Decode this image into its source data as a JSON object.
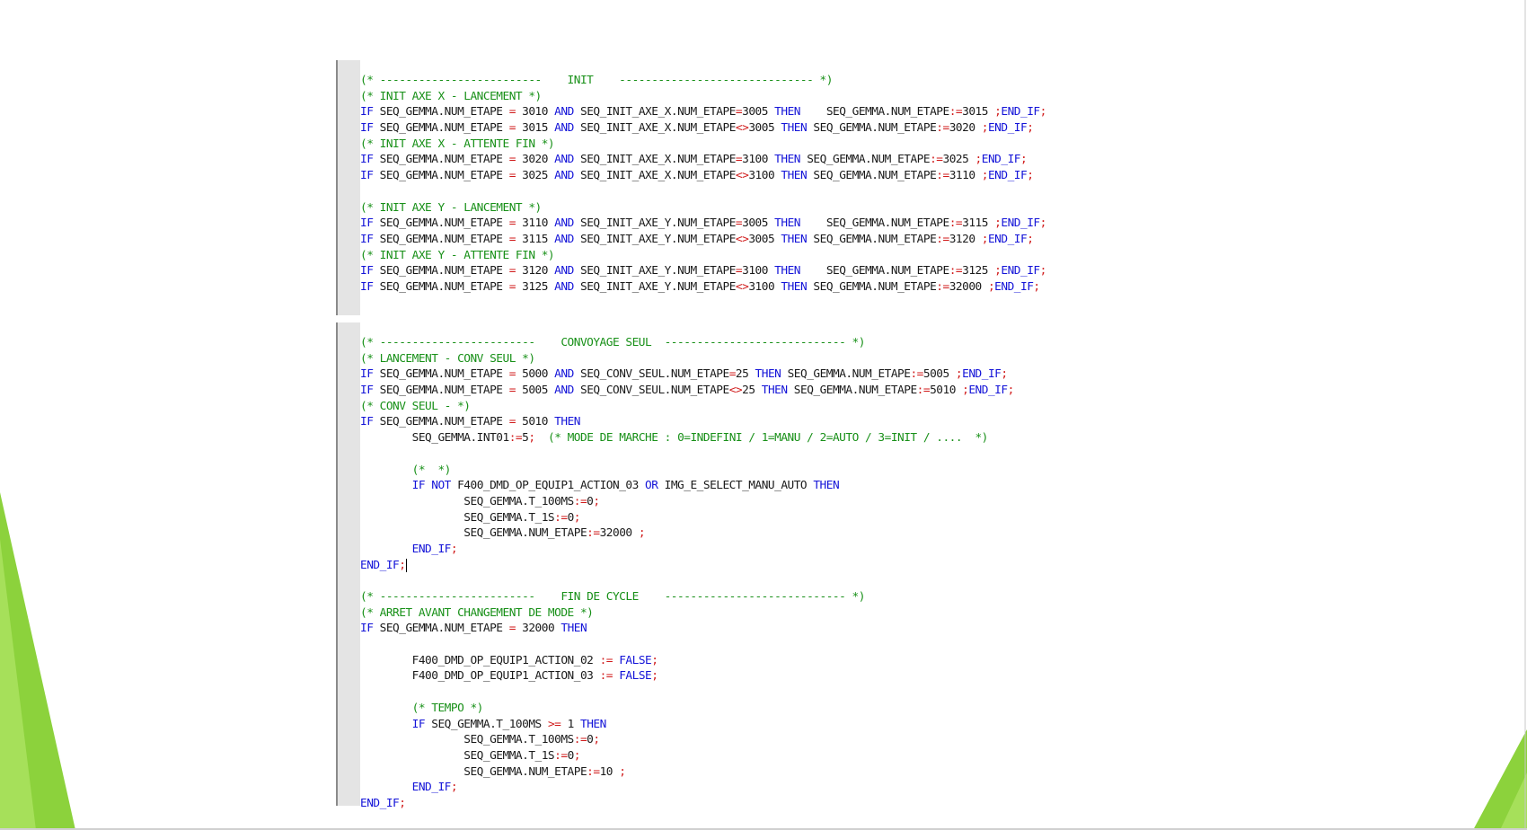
{
  "colors": {
    "keyword": "#1414d8",
    "operator": "#d01a1a",
    "comment": "#189018",
    "identifier": "#1a1a1a",
    "gutter": "#e4e4e4",
    "slide_accent": "#8cd23c"
  },
  "editors": [
    {
      "name": "init",
      "lines": [
        [
          [
            "cm",
            "(* -------------------------    INIT    ------------------------------ *)"
          ]
        ],
        [
          [
            "cm",
            "(* INIT AXE X - LANCEMENT *)"
          ]
        ],
        [
          [
            "kw",
            "IF"
          ],
          [
            "id",
            " SEQ_GEMMA.NUM_ETAPE "
          ],
          [
            "op",
            "="
          ],
          [
            "id",
            " 3010 "
          ],
          [
            "kw",
            "AND"
          ],
          [
            "id",
            " SEQ_INIT_AXE_X.NUM_ETAPE"
          ],
          [
            "op",
            "="
          ],
          [
            "id",
            "3005 "
          ],
          [
            "kw",
            "THEN"
          ],
          [
            "id",
            "    SEQ_GEMMA.NUM_ETAPE"
          ],
          [
            "op",
            ":="
          ],
          [
            "id",
            "3015 "
          ],
          [
            "op",
            ";"
          ],
          [
            "kw",
            "END_IF"
          ],
          [
            "op",
            ";"
          ]
        ],
        [
          [
            "kw",
            "IF"
          ],
          [
            "id",
            " SEQ_GEMMA.NUM_ETAPE "
          ],
          [
            "op",
            "="
          ],
          [
            "id",
            " 3015 "
          ],
          [
            "kw",
            "AND"
          ],
          [
            "id",
            " SEQ_INIT_AXE_X.NUM_ETAPE"
          ],
          [
            "op",
            "<>"
          ],
          [
            "id",
            "3005 "
          ],
          [
            "kw",
            "THEN"
          ],
          [
            "id",
            " SEQ_GEMMA.NUM_ETAPE"
          ],
          [
            "op",
            ":="
          ],
          [
            "id",
            "3020 "
          ],
          [
            "op",
            ";"
          ],
          [
            "kw",
            "END_IF"
          ],
          [
            "op",
            ";"
          ]
        ],
        [
          [
            "cm",
            "(* INIT AXE X - ATTENTE FIN *)"
          ]
        ],
        [
          [
            "kw",
            "IF"
          ],
          [
            "id",
            " SEQ_GEMMA.NUM_ETAPE "
          ],
          [
            "op",
            "="
          ],
          [
            "id",
            " 3020 "
          ],
          [
            "kw",
            "AND"
          ],
          [
            "id",
            " SEQ_INIT_AXE_X.NUM_ETAPE"
          ],
          [
            "op",
            "="
          ],
          [
            "id",
            "3100 "
          ],
          [
            "kw",
            "THEN"
          ],
          [
            "id",
            " SEQ_GEMMA.NUM_ETAPE"
          ],
          [
            "op",
            ":="
          ],
          [
            "id",
            "3025 "
          ],
          [
            "op",
            ";"
          ],
          [
            "kw",
            "END_IF"
          ],
          [
            "op",
            ";"
          ]
        ],
        [
          [
            "kw",
            "IF"
          ],
          [
            "id",
            " SEQ_GEMMA.NUM_ETAPE "
          ],
          [
            "op",
            "="
          ],
          [
            "id",
            " 3025 "
          ],
          [
            "kw",
            "AND"
          ],
          [
            "id",
            " SEQ_INIT_AXE_X.NUM_ETAPE"
          ],
          [
            "op",
            "<>"
          ],
          [
            "id",
            "3100 "
          ],
          [
            "kw",
            "THEN"
          ],
          [
            "id",
            " SEQ_GEMMA.NUM_ETAPE"
          ],
          [
            "op",
            ":="
          ],
          [
            "id",
            "3110 "
          ],
          [
            "op",
            ";"
          ],
          [
            "kw",
            "END_IF"
          ],
          [
            "op",
            ";"
          ]
        ],
        [],
        [
          [
            "cm",
            "(* INIT AXE Y - LANCEMENT *)"
          ]
        ],
        [
          [
            "kw",
            "IF"
          ],
          [
            "id",
            " SEQ_GEMMA.NUM_ETAPE "
          ],
          [
            "op",
            "="
          ],
          [
            "id",
            " 3110 "
          ],
          [
            "kw",
            "AND"
          ],
          [
            "id",
            " SEQ_INIT_AXE_Y.NUM_ETAPE"
          ],
          [
            "op",
            "="
          ],
          [
            "id",
            "3005 "
          ],
          [
            "kw",
            "THEN"
          ],
          [
            "id",
            "    SEQ_GEMMA.NUM_ETAPE"
          ],
          [
            "op",
            ":="
          ],
          [
            "id",
            "3115 "
          ],
          [
            "op",
            ";"
          ],
          [
            "kw",
            "END_IF"
          ],
          [
            "op",
            ";"
          ]
        ],
        [
          [
            "kw",
            "IF"
          ],
          [
            "id",
            " SEQ_GEMMA.NUM_ETAPE "
          ],
          [
            "op",
            "="
          ],
          [
            "id",
            " 3115 "
          ],
          [
            "kw",
            "AND"
          ],
          [
            "id",
            " SEQ_INIT_AXE_Y.NUM_ETAPE"
          ],
          [
            "op",
            "<>"
          ],
          [
            "id",
            "3005 "
          ],
          [
            "kw",
            "THEN"
          ],
          [
            "id",
            " SEQ_GEMMA.NUM_ETAPE"
          ],
          [
            "op",
            ":="
          ],
          [
            "id",
            "3120 "
          ],
          [
            "op",
            ";"
          ],
          [
            "kw",
            "END_IF"
          ],
          [
            "op",
            ";"
          ]
        ],
        [
          [
            "cm",
            "(* INIT AXE Y - ATTENTE FIN *)"
          ]
        ],
        [
          [
            "kw",
            "IF"
          ],
          [
            "id",
            " SEQ_GEMMA.NUM_ETAPE "
          ],
          [
            "op",
            "="
          ],
          [
            "id",
            " 3120 "
          ],
          [
            "kw",
            "AND"
          ],
          [
            "id",
            " SEQ_INIT_AXE_Y.NUM_ETAPE"
          ],
          [
            "op",
            "="
          ],
          [
            "id",
            "3100 "
          ],
          [
            "kw",
            "THEN"
          ],
          [
            "id",
            "    SEQ_GEMMA.NUM_ETAPE"
          ],
          [
            "op",
            ":="
          ],
          [
            "id",
            "3125 "
          ],
          [
            "op",
            ";"
          ],
          [
            "kw",
            "END_IF"
          ],
          [
            "op",
            ";"
          ]
        ],
        [
          [
            "kw",
            "IF"
          ],
          [
            "id",
            " SEQ_GEMMA.NUM_ETAPE "
          ],
          [
            "op",
            "="
          ],
          [
            "id",
            " 3125 "
          ],
          [
            "kw",
            "AND"
          ],
          [
            "id",
            " SEQ_INIT_AXE_Y.NUM_ETAPE"
          ],
          [
            "op",
            "<>"
          ],
          [
            "id",
            "3100 "
          ],
          [
            "kw",
            "THEN"
          ],
          [
            "id",
            " SEQ_GEMMA.NUM_ETAPE"
          ],
          [
            "op",
            ":="
          ],
          [
            "id",
            "32000 "
          ],
          [
            "op",
            ";"
          ],
          [
            "kw",
            "END_IF"
          ],
          [
            "op",
            ";"
          ]
        ]
      ]
    },
    {
      "name": "convoyage",
      "lines": [
        [
          [
            "cm",
            "(* ------------------------    CONVOYAGE SEUL  ---------------------------- *)"
          ]
        ],
        [
          [
            "cm",
            "(* LANCEMENT - CONV SEUL *)"
          ]
        ],
        [
          [
            "kw",
            "IF"
          ],
          [
            "id",
            " SEQ_GEMMA.NUM_ETAPE "
          ],
          [
            "op",
            "="
          ],
          [
            "id",
            " 5000 "
          ],
          [
            "kw",
            "AND"
          ],
          [
            "id",
            " SEQ_CONV_SEUL.NUM_ETAPE"
          ],
          [
            "op",
            "="
          ],
          [
            "id",
            "25 "
          ],
          [
            "kw",
            "THEN"
          ],
          [
            "id",
            " SEQ_GEMMA.NUM_ETAPE"
          ],
          [
            "op",
            ":="
          ],
          [
            "id",
            "5005 "
          ],
          [
            "op",
            ";"
          ],
          [
            "kw",
            "END_IF"
          ],
          [
            "op",
            ";"
          ]
        ],
        [
          [
            "kw",
            "IF"
          ],
          [
            "id",
            " SEQ_GEMMA.NUM_ETAPE "
          ],
          [
            "op",
            "="
          ],
          [
            "id",
            " 5005 "
          ],
          [
            "kw",
            "AND"
          ],
          [
            "id",
            " SEQ_CONV_SEUL.NUM_ETAPE"
          ],
          [
            "op",
            "<>"
          ],
          [
            "id",
            "25 "
          ],
          [
            "kw",
            "THEN"
          ],
          [
            "id",
            " SEQ_GEMMA.NUM_ETAPE"
          ],
          [
            "op",
            ":="
          ],
          [
            "id",
            "5010 "
          ],
          [
            "op",
            ";"
          ],
          [
            "kw",
            "END_IF"
          ],
          [
            "op",
            ";"
          ]
        ],
        [
          [
            "cm",
            "(* CONV SEUL - *)"
          ]
        ],
        [
          [
            "kw",
            "IF"
          ],
          [
            "id",
            " SEQ_GEMMA.NUM_ETAPE "
          ],
          [
            "op",
            "="
          ],
          [
            "id",
            " 5010 "
          ],
          [
            "kw",
            "THEN"
          ]
        ],
        [
          [
            "id",
            "        SEQ_GEMMA.INT01"
          ],
          [
            "op",
            ":="
          ],
          [
            "id",
            "5"
          ],
          [
            "op",
            ";"
          ],
          [
            "id",
            "  "
          ],
          [
            "cm",
            "(* MODE DE MARCHE : 0=INDEFINI / 1=MANU / 2=AUTO / 3=INIT / ....  *)"
          ]
        ],
        [],
        [
          [
            "id",
            "        "
          ],
          [
            "cm",
            "(*  *)"
          ]
        ],
        [
          [
            "id",
            "        "
          ],
          [
            "kw",
            "IF NOT"
          ],
          [
            "id",
            " F400_DMD_OP_EQUIP1_ACTION_03 "
          ],
          [
            "kw",
            "OR"
          ],
          [
            "id",
            " IMG_E_SELECT_MANU_AUTO "
          ],
          [
            "kw",
            "THEN"
          ]
        ],
        [
          [
            "id",
            "                SEQ_GEMMA.T_100MS"
          ],
          [
            "op",
            ":="
          ],
          [
            "id",
            "0"
          ],
          [
            "op",
            ";"
          ]
        ],
        [
          [
            "id",
            "                SEQ_GEMMA.T_1S"
          ],
          [
            "op",
            ":="
          ],
          [
            "id",
            "0"
          ],
          [
            "op",
            ";"
          ]
        ],
        [
          [
            "id",
            "                SEQ_GEMMA.NUM_ETAPE"
          ],
          [
            "op",
            ":="
          ],
          [
            "id",
            "32000 "
          ],
          [
            "op",
            ";"
          ]
        ],
        [
          [
            "id",
            "        "
          ],
          [
            "kw",
            "END_IF"
          ],
          [
            "op",
            ";"
          ]
        ],
        [
          [
            "kw",
            "END_IF"
          ],
          [
            "op",
            ";"
          ],
          [
            "caret",
            ""
          ]
        ],
        [],
        [
          [
            "cm",
            "(* ------------------------    FIN DE CYCLE    ---------------------------- *)"
          ]
        ],
        [
          [
            "cm",
            "(* ARRET AVANT CHANGEMENT DE MODE *)"
          ]
        ],
        [
          [
            "kw",
            "IF"
          ],
          [
            "id",
            " SEQ_GEMMA.NUM_ETAPE "
          ],
          [
            "op",
            "="
          ],
          [
            "id",
            " 32000 "
          ],
          [
            "kw",
            "THEN"
          ]
        ],
        [],
        [
          [
            "id",
            "        F400_DMD_OP_EQUIP1_ACTION_02 "
          ],
          [
            "op",
            ":="
          ],
          [
            "id",
            " "
          ],
          [
            "kw",
            "FALSE"
          ],
          [
            "op",
            ";"
          ]
        ],
        [
          [
            "id",
            "        F400_DMD_OP_EQUIP1_ACTION_03 "
          ],
          [
            "op",
            ":="
          ],
          [
            "id",
            " "
          ],
          [
            "kw",
            "FALSE"
          ],
          [
            "op",
            ";"
          ]
        ],
        [],
        [
          [
            "id",
            "        "
          ],
          [
            "cm",
            "(* TEMPO *)"
          ]
        ],
        [
          [
            "id",
            "        "
          ],
          [
            "kw",
            "IF"
          ],
          [
            "id",
            " SEQ_GEMMA.T_100MS "
          ],
          [
            "op",
            ">="
          ],
          [
            "id",
            " 1 "
          ],
          [
            "kw",
            "THEN"
          ]
        ],
        [
          [
            "id",
            "                SEQ_GEMMA.T_100MS"
          ],
          [
            "op",
            ":="
          ],
          [
            "id",
            "0"
          ],
          [
            "op",
            ";"
          ]
        ],
        [
          [
            "id",
            "                SEQ_GEMMA.T_1S"
          ],
          [
            "op",
            ":="
          ],
          [
            "id",
            "0"
          ],
          [
            "op",
            ";"
          ]
        ],
        [
          [
            "id",
            "                SEQ_GEMMA.NUM_ETAPE"
          ],
          [
            "op",
            ":="
          ],
          [
            "id",
            "10 "
          ],
          [
            "op",
            ";"
          ]
        ],
        [
          [
            "id",
            "        "
          ],
          [
            "kw",
            "END_IF"
          ],
          [
            "op",
            ";"
          ]
        ],
        [
          [
            "kw",
            "END_IF"
          ],
          [
            "op",
            ";"
          ]
        ]
      ]
    }
  ]
}
